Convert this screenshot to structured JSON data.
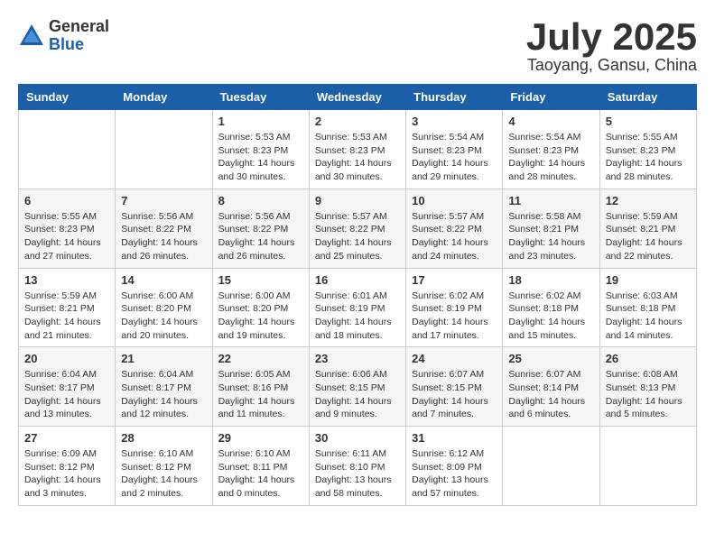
{
  "header": {
    "logo_general": "General",
    "logo_blue": "Blue",
    "month_year": "July 2025",
    "location": "Taoyang, Gansu, China"
  },
  "weekdays": [
    "Sunday",
    "Monday",
    "Tuesday",
    "Wednesday",
    "Thursday",
    "Friday",
    "Saturday"
  ],
  "weeks": [
    [
      {
        "day": "",
        "info": ""
      },
      {
        "day": "",
        "info": ""
      },
      {
        "day": "1",
        "info": "Sunrise: 5:53 AM\nSunset: 8:23 PM\nDaylight: 14 hours and 30 minutes."
      },
      {
        "day": "2",
        "info": "Sunrise: 5:53 AM\nSunset: 8:23 PM\nDaylight: 14 hours and 30 minutes."
      },
      {
        "day": "3",
        "info": "Sunrise: 5:54 AM\nSunset: 8:23 PM\nDaylight: 14 hours and 29 minutes."
      },
      {
        "day": "4",
        "info": "Sunrise: 5:54 AM\nSunset: 8:23 PM\nDaylight: 14 hours and 28 minutes."
      },
      {
        "day": "5",
        "info": "Sunrise: 5:55 AM\nSunset: 8:23 PM\nDaylight: 14 hours and 28 minutes."
      }
    ],
    [
      {
        "day": "6",
        "info": "Sunrise: 5:55 AM\nSunset: 8:23 PM\nDaylight: 14 hours and 27 minutes."
      },
      {
        "day": "7",
        "info": "Sunrise: 5:56 AM\nSunset: 8:22 PM\nDaylight: 14 hours and 26 minutes."
      },
      {
        "day": "8",
        "info": "Sunrise: 5:56 AM\nSunset: 8:22 PM\nDaylight: 14 hours and 26 minutes."
      },
      {
        "day": "9",
        "info": "Sunrise: 5:57 AM\nSunset: 8:22 PM\nDaylight: 14 hours and 25 minutes."
      },
      {
        "day": "10",
        "info": "Sunrise: 5:57 AM\nSunset: 8:22 PM\nDaylight: 14 hours and 24 minutes."
      },
      {
        "day": "11",
        "info": "Sunrise: 5:58 AM\nSunset: 8:21 PM\nDaylight: 14 hours and 23 minutes."
      },
      {
        "day": "12",
        "info": "Sunrise: 5:59 AM\nSunset: 8:21 PM\nDaylight: 14 hours and 22 minutes."
      }
    ],
    [
      {
        "day": "13",
        "info": "Sunrise: 5:59 AM\nSunset: 8:21 PM\nDaylight: 14 hours and 21 minutes."
      },
      {
        "day": "14",
        "info": "Sunrise: 6:00 AM\nSunset: 8:20 PM\nDaylight: 14 hours and 20 minutes."
      },
      {
        "day": "15",
        "info": "Sunrise: 6:00 AM\nSunset: 8:20 PM\nDaylight: 14 hours and 19 minutes."
      },
      {
        "day": "16",
        "info": "Sunrise: 6:01 AM\nSunset: 8:19 PM\nDaylight: 14 hours and 18 minutes."
      },
      {
        "day": "17",
        "info": "Sunrise: 6:02 AM\nSunset: 8:19 PM\nDaylight: 14 hours and 17 minutes."
      },
      {
        "day": "18",
        "info": "Sunrise: 6:02 AM\nSunset: 8:18 PM\nDaylight: 14 hours and 15 minutes."
      },
      {
        "day": "19",
        "info": "Sunrise: 6:03 AM\nSunset: 8:18 PM\nDaylight: 14 hours and 14 minutes."
      }
    ],
    [
      {
        "day": "20",
        "info": "Sunrise: 6:04 AM\nSunset: 8:17 PM\nDaylight: 14 hours and 13 minutes."
      },
      {
        "day": "21",
        "info": "Sunrise: 6:04 AM\nSunset: 8:17 PM\nDaylight: 14 hours and 12 minutes."
      },
      {
        "day": "22",
        "info": "Sunrise: 6:05 AM\nSunset: 8:16 PM\nDaylight: 14 hours and 11 minutes."
      },
      {
        "day": "23",
        "info": "Sunrise: 6:06 AM\nSunset: 8:15 PM\nDaylight: 14 hours and 9 minutes."
      },
      {
        "day": "24",
        "info": "Sunrise: 6:07 AM\nSunset: 8:15 PM\nDaylight: 14 hours and 7 minutes."
      },
      {
        "day": "25",
        "info": "Sunrise: 6:07 AM\nSunset: 8:14 PM\nDaylight: 14 hours and 6 minutes."
      },
      {
        "day": "26",
        "info": "Sunrise: 6:08 AM\nSunset: 8:13 PM\nDaylight: 14 hours and 5 minutes."
      }
    ],
    [
      {
        "day": "27",
        "info": "Sunrise: 6:09 AM\nSunset: 8:12 PM\nDaylight: 14 hours and 3 minutes."
      },
      {
        "day": "28",
        "info": "Sunrise: 6:10 AM\nSunset: 8:12 PM\nDaylight: 14 hours and 2 minutes."
      },
      {
        "day": "29",
        "info": "Sunrise: 6:10 AM\nSunset: 8:11 PM\nDaylight: 14 hours and 0 minutes."
      },
      {
        "day": "30",
        "info": "Sunrise: 6:11 AM\nSunset: 8:10 PM\nDaylight: 13 hours and 58 minutes."
      },
      {
        "day": "31",
        "info": "Sunrise: 6:12 AM\nSunset: 8:09 PM\nDaylight: 13 hours and 57 minutes."
      },
      {
        "day": "",
        "info": ""
      },
      {
        "day": "",
        "info": ""
      }
    ]
  ]
}
